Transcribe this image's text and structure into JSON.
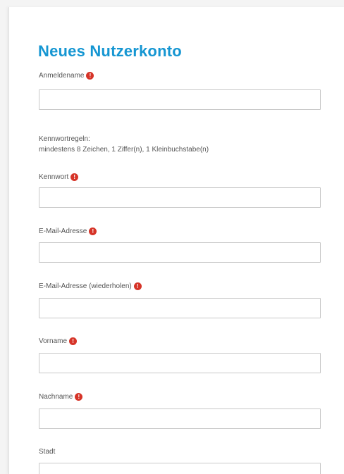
{
  "form": {
    "title": "Neues Nutzerkonto",
    "required_icon": "exclamation-required-icon",
    "required_color": "#d63428",
    "title_color": "#1596d2",
    "password_rules": {
      "heading": "Kennwortregeln:",
      "text": "mindestens 8 Zeichen, 1 Ziffer(n), 1 Kleinbuchstabe(n)"
    },
    "fields": {
      "username": {
        "label": "Anmeldename",
        "value": ""
      },
      "password": {
        "label": "Kennwort",
        "value": ""
      },
      "email": {
        "label": "E-Mail-Adresse",
        "value": ""
      },
      "email_repeat": {
        "label": "E-Mail-Adresse (wiederholen)",
        "value": ""
      },
      "firstname": {
        "label": "Vorname",
        "value": ""
      },
      "lastname": {
        "label": "Nachname",
        "value": ""
      },
      "city": {
        "label": "Stadt",
        "value": ""
      }
    }
  }
}
